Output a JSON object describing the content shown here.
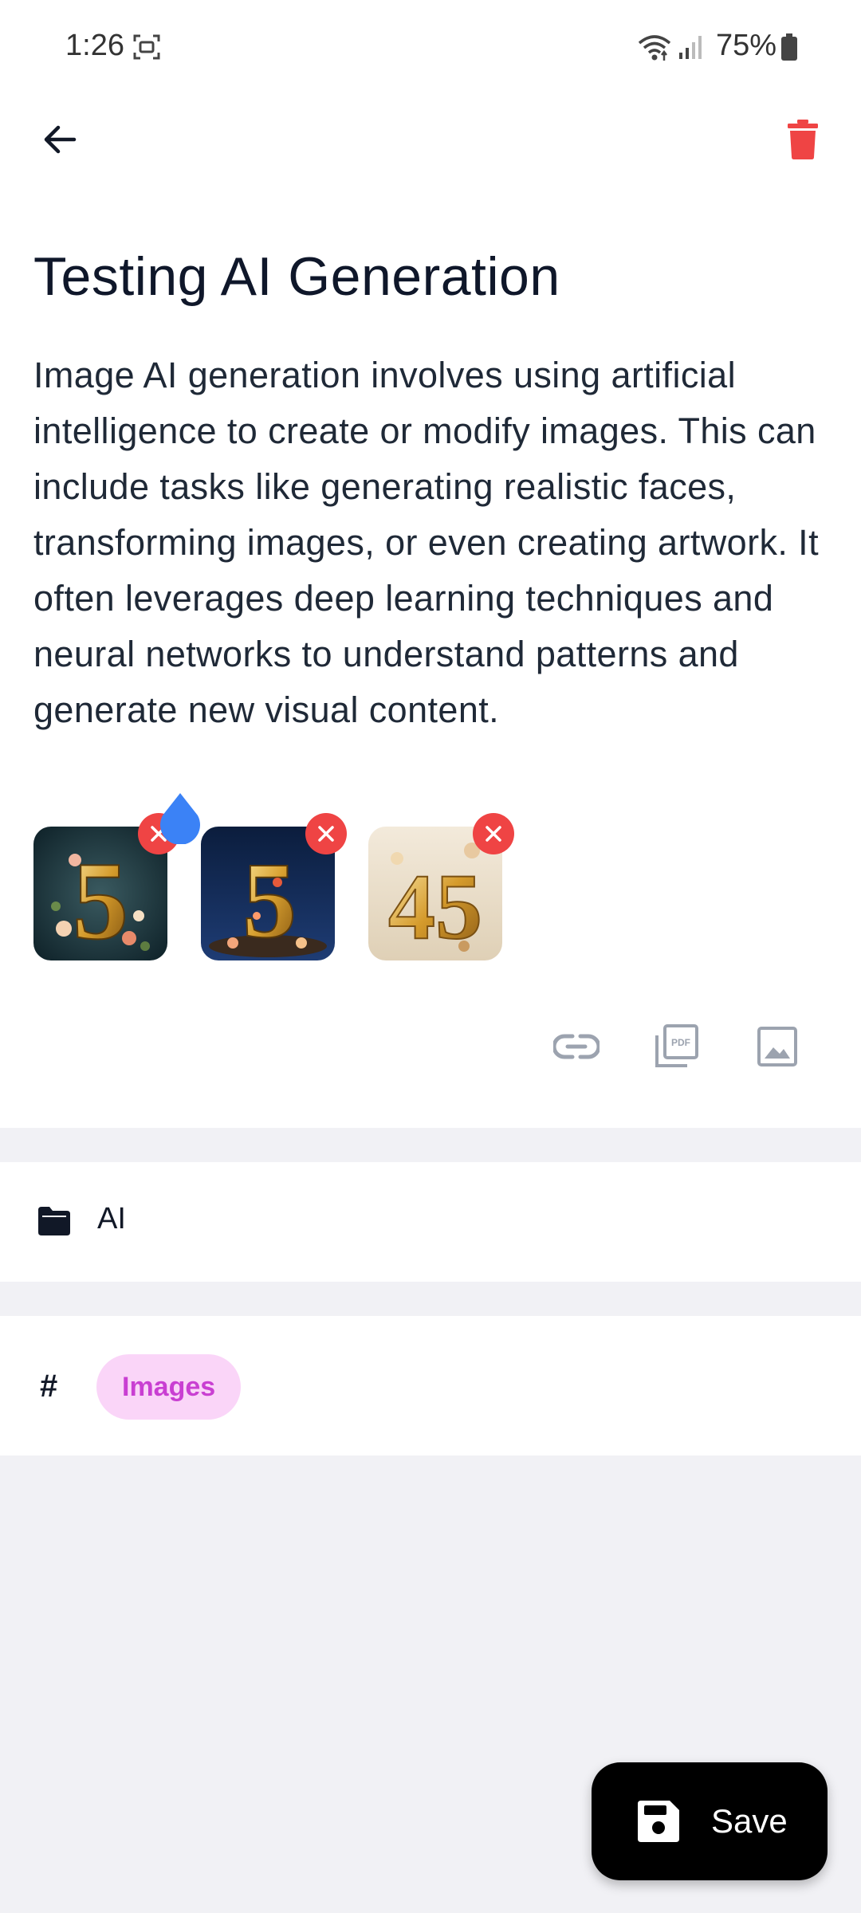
{
  "status_bar": {
    "time": "1:26",
    "battery": "75%"
  },
  "header": {
    "back_icon": "arrow-left-icon",
    "delete_icon": "trash-icon",
    "delete_color": "#ef4444"
  },
  "note": {
    "title": "Testing AI Generation",
    "body": "Image AI generation involves using artificial intelligence to create or modify images. This can include tasks like generating realistic faces, transforming images, or even creating artwork. It often leverages deep learning techniques and neural networks to understand patterns and generate new visual content."
  },
  "images": [
    {
      "label": "5"
    },
    {
      "label": "5"
    },
    {
      "label": "45"
    }
  ],
  "attachments": {
    "pdf_label": "PDF"
  },
  "folder": {
    "label": "AI"
  },
  "tags": {
    "hash": "#",
    "items": [
      "Images"
    ]
  },
  "save": {
    "label": "Save"
  },
  "colors": {
    "accent_red": "#ef4444",
    "tag_bg": "#fad5f8",
    "tag_text": "#c93fd2",
    "drag_handle": "#3b82f6"
  }
}
